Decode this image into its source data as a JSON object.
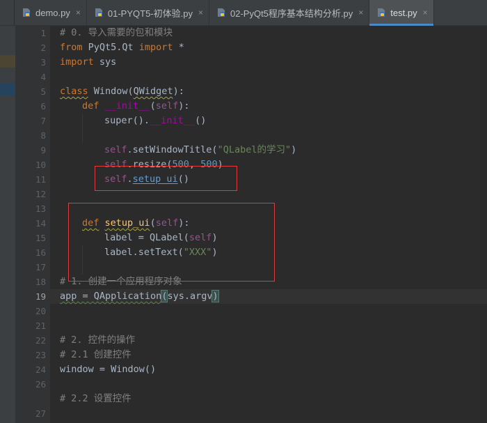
{
  "tabs": [
    {
      "label": "demo.py",
      "active": false
    },
    {
      "label": "01-PYQT5-初体验.py",
      "active": false
    },
    {
      "label": "02-PyQt5程序基本结构分析.py",
      "active": false
    },
    {
      "label": "test.py",
      "active": true
    }
  ],
  "close_glyph": "×",
  "current_line": "19",
  "line_numbers": [
    "1",
    "2",
    "3",
    "4",
    "5",
    "6",
    "7",
    "8",
    "9",
    "10",
    "11",
    "12",
    "13",
    "14",
    "15",
    "16",
    "17",
    "18",
    "19",
    "20",
    "21",
    "22",
    "23",
    "24",
    "26",
    "27"
  ],
  "code": {
    "l1_comment": "# 0. 导入需要的包和模块",
    "l2_from": "from",
    "l2_mod": " PyQt5.Qt ",
    "l2_import": "import",
    "l2_star": " *",
    "l3_import": "import",
    "l3_mod": " sys",
    "l5_class": "class",
    "l5_name": " Window(",
    "l5_base": "QWidget",
    "l5_end": "):",
    "l6_def": "def",
    "l6_sp": " ",
    "l6_name": "__init__",
    "l6_open": "(",
    "l6_self": "self",
    "l6_end": "):",
    "l7_super": "super().",
    "l7_init": "__init__",
    "l7_end": "()",
    "l9_self": "self",
    "l9_call": ".setWindowTitle(",
    "l9_str": "\"QLabel的学习\"",
    "l9_end": ")",
    "l10_self": "self",
    "l10_call": ".resize(",
    "l10_n1": "500",
    "l10_sep": ", ",
    "l10_n2": "500",
    "l10_end": ")",
    "l11_self": "self",
    "l11_dot": ".",
    "l11_call": "setup_ui",
    "l11_end": "()",
    "l14_def": "def",
    "l14_sp": " ",
    "l14_name": "setup_ui",
    "l14_open": "(",
    "l14_self": "self",
    "l14_end": "):",
    "l15_a": "label = QLabel(",
    "l15_self": "self",
    "l15_end": ")",
    "l16_a": "label.setText(",
    "l16_str": "\"XXX\"",
    "l16_end": ")",
    "l18_comment": "# 1. 创建一个应用程序对象",
    "l19_a": "app = QApplication",
    "l19_open": "(",
    "l19_mid": "sys.argv",
    "l19_close": ")",
    "l22_comment": "# 2. 控件的操作",
    "l23_comment": "# 2.1 创建控件",
    "l24_code": "window = Window()",
    "l26_comment": "# 2.2 设置控件"
  }
}
